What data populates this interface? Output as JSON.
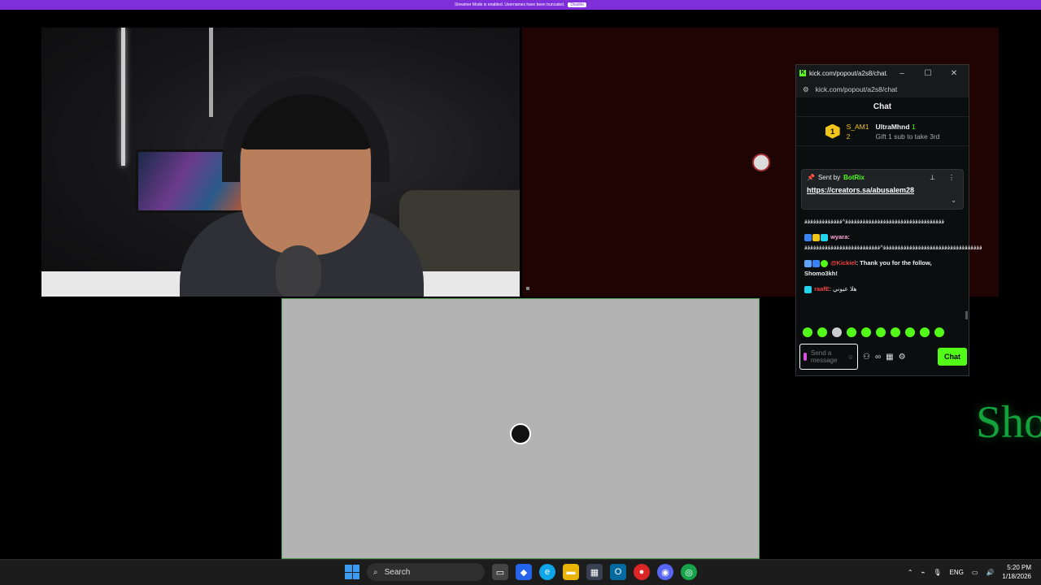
{
  "banner": {
    "text": "Streamer Mode is enabled. Usernames have been truncated.",
    "button": "Disable"
  },
  "overlay_text": "Sho",
  "chat_window": {
    "window_title": "kick.com/popout/a2s8/chat...",
    "url": "kick.com/popout/a2s8/chat",
    "header": "Chat",
    "leaderboard": {
      "rank": "1",
      "first_user": "S_AM1",
      "first_count": "2",
      "second_user": "UltraMhnd",
      "second_count": "1",
      "gift_text": "Gift 1 sub to take 3rd"
    },
    "pinned": {
      "sent_by_label": "Sent by",
      "sender": "BotRix",
      "link": "https://creators.sa/abusalem28"
    },
    "messages": [
      {
        "user": "",
        "text": "ﻗﻗﻗﻗﻗﻗﻗﻗﻗﻗﻗﻗﻗﻗﻗﻗﻗﻗﻗﻗﻗﻗﻗﻗﻗﻗﻗﻗﻗﻗﻗﻗﻗﻗ^ﻗﻗﻗﻗﻗﻗﻗﻗﻗﻗﻗﻗﻗ"
      },
      {
        "user": "wyara:",
        "text": "ﻗﻗﻗﻗﻗﻗﻗﻗﻗﻗﻗﻗﻗﻗﻗﻗﻗﻗﻗﻗﻗﻗﻗﻗﻗﻗﻗﻗﻗﻗﻗﻗﻗﻗ^ﻗﻗﻗﻗﻗﻗﻗﻗﻗﻗﻗﻗﻗﻗﻗﻗﻗﻗﻗﻗﻗﻗﻗﻗﻗﻗ"
      },
      {
        "user": "@Kickiel",
        "text": ": Thank you for the follow, Shomo3kh!"
      },
      {
        "user": "raafE",
        "text": ": هلا عيوني"
      }
    ],
    "input_placeholder": "Send a message",
    "send_button": "Chat"
  },
  "taskbar": {
    "search": "Search",
    "language": "ENG",
    "time": "5:20 PM",
    "date": "1/18/2026"
  },
  "colors": {
    "kick_green": "#53fc18",
    "banner_purple": "#7f2fd9",
    "taskbar": "#1c1c1c"
  }
}
